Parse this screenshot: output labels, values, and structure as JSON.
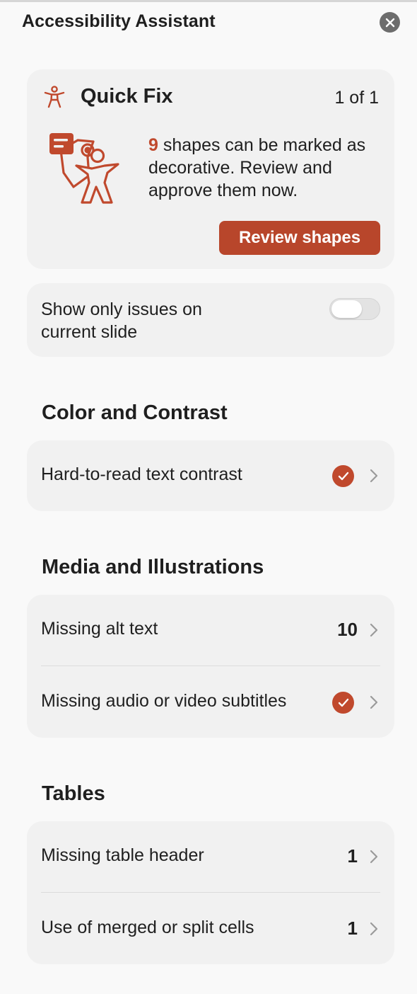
{
  "pane": {
    "title": "Accessibility Assistant",
    "close_icon": "close-icon"
  },
  "quick_fix": {
    "title": "Quick Fix",
    "counter": "1 of 1",
    "icon": "accessibility-person-icon",
    "illustration": "decorative-shapes-illustration",
    "message_count": "9",
    "message_text": " shapes can be marked as decorative. Review and approve them now.",
    "button_label": "Review shapes",
    "accent_color": "#c0492d"
  },
  "filter": {
    "label": "Show only issues on current slide",
    "toggle_on": false
  },
  "sections": {
    "color_contrast": {
      "heading": "Color and Contrast",
      "rows": [
        {
          "label": "Hard-to-read text contrast",
          "status": "check-icon"
        }
      ]
    },
    "media": {
      "heading": "Media and Illustrations",
      "rows": [
        {
          "label": "Missing alt text",
          "count": "10"
        },
        {
          "label": "Missing audio or video subtitles",
          "status": "check-icon"
        }
      ]
    },
    "tables": {
      "heading": "Tables",
      "rows": [
        {
          "label": "Missing table header",
          "count": "1"
        },
        {
          "label": "Use of merged or split cells",
          "count": "1"
        }
      ]
    }
  }
}
